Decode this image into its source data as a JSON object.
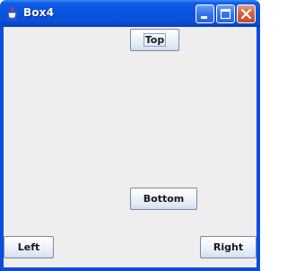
{
  "window": {
    "title": "Box4",
    "app_icon": "java-cup-icon",
    "controls": {
      "minimize": "minimize-icon",
      "maximize": "maximize-icon",
      "close": "close-icon"
    },
    "colors": {
      "titlebar": "#0a53e0",
      "content_background": "#eeeeee",
      "close_button": "#d8603f"
    }
  },
  "buttons": {
    "top": "Top",
    "bottom": "Bottom",
    "left": "Left",
    "right": "Right"
  }
}
